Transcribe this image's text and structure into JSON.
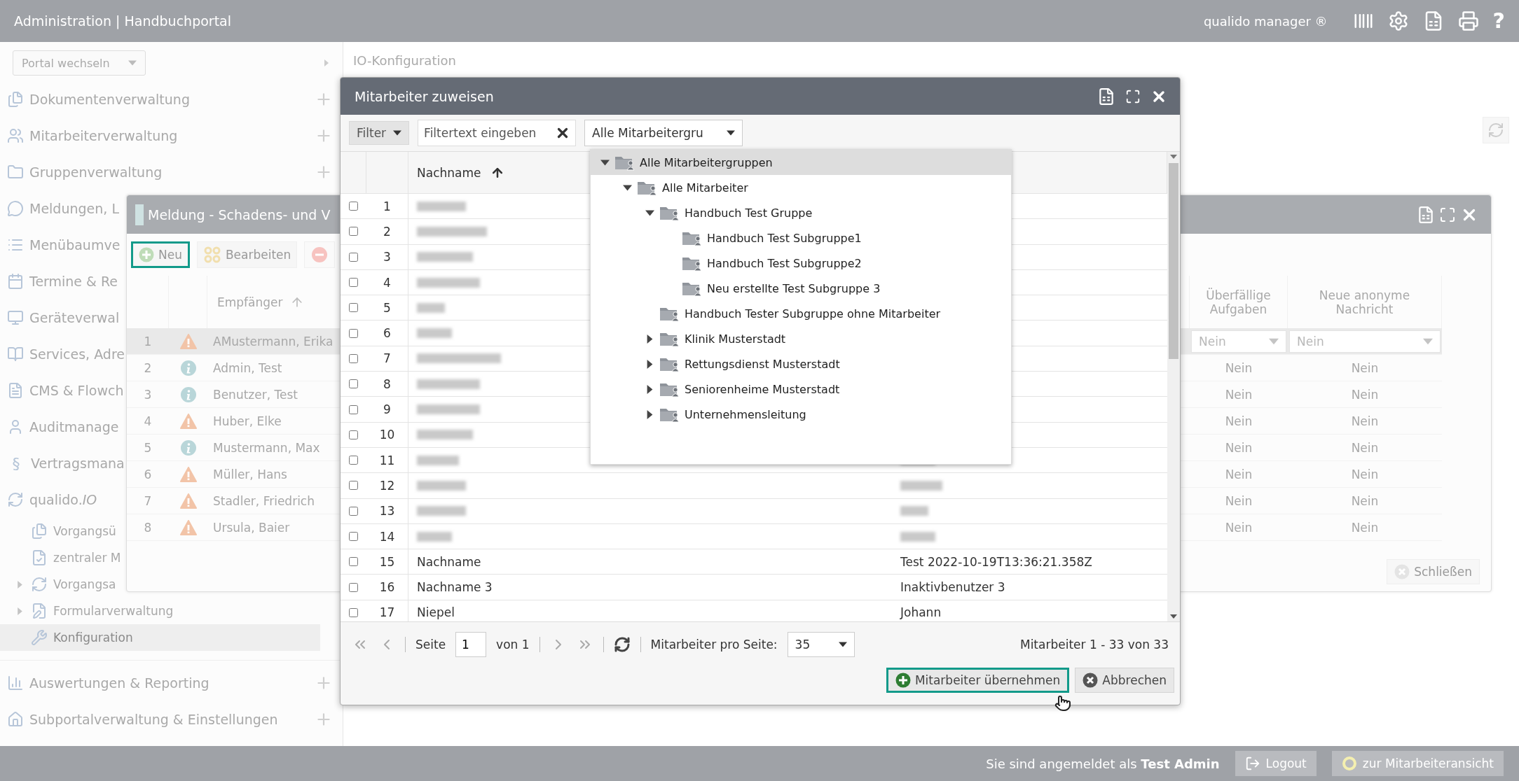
{
  "header": {
    "title": "Administration | Handbuchportal",
    "brand": "qualido manager ®",
    "help": "?"
  },
  "sidebar": {
    "portal_select": "Portal wechseln",
    "items": [
      {
        "label": "Dokumentenverwaltung",
        "expandable": true
      },
      {
        "label": "Mitarbeiterverwaltung",
        "expandable": true
      },
      {
        "label": "Gruppenverwaltung",
        "expandable": true
      },
      {
        "label": "Meldungen, L"
      },
      {
        "label": "Menübaumve"
      },
      {
        "label": "Termine & Re"
      },
      {
        "label": "Geräteverwal"
      },
      {
        "label": "Services, Adre"
      },
      {
        "label": "CMS & Flowch"
      },
      {
        "label": "Auditmanage"
      },
      {
        "label": "Vertragsmana",
        "glyph": "§"
      },
      {
        "label": "qualido.*IO*",
        "children": [
          {
            "label": "Vorgangsü",
            "expandable": false,
            "selected": false
          },
          {
            "label": "zentraler M",
            "expandable": false,
            "selected": false
          },
          {
            "label": "Vorgangsa",
            "expandable": true,
            "selected": false
          },
          {
            "label": "Formularverwaltung",
            "expandable": true,
            "selected": false
          },
          {
            "label": "Konfiguration",
            "expandable": false,
            "selected": true
          }
        ]
      },
      {
        "label": "Auswertungen & Reporting",
        "expandable": true
      },
      {
        "label": "Subportalverwaltung & Einstellungen",
        "expandable": true
      }
    ]
  },
  "page": {
    "title": "IO-Konfiguration"
  },
  "background_dialog": {
    "title": "Meldung - Schadens- und V",
    "toolbar": [
      {
        "label": "Neu",
        "focused": true
      },
      {
        "label": "Bearbeiten",
        "focused": false
      }
    ],
    "columns": [
      "Empfänger",
      "Überfällige Aufgaben",
      "Neue anonyme Nachricht"
    ],
    "rows": [
      {
        "index": "1",
        "kind": "warning",
        "name": "AMustermann, Erika",
        "selected": true,
        "filters": [
          "Nein",
          "Nein"
        ]
      },
      {
        "index": "2",
        "kind": "info",
        "name": "Admin, Test",
        "selected": false,
        "cells": [
          "Nein",
          "Nein"
        ]
      },
      {
        "index": "3",
        "kind": "info",
        "name": "Benutzer, Test",
        "selected": false,
        "cells": [
          "Nein",
          "Nein"
        ]
      },
      {
        "index": "4",
        "kind": "warning",
        "name": "Huber, Elke",
        "selected": false,
        "cells": [
          "Nein",
          "Nein"
        ]
      },
      {
        "index": "5",
        "kind": "info",
        "name": "Mustermann, Max",
        "selected": false,
        "cells": [
          "Nein",
          "Nein"
        ]
      },
      {
        "index": "6",
        "kind": "warning",
        "name": "Müller, Hans",
        "selected": false,
        "cells": [
          "Nein",
          "Nein"
        ]
      },
      {
        "index": "7",
        "kind": "warning",
        "name": "Stadler, Friedrich",
        "selected": false,
        "cells": [
          "Nein",
          "Nein"
        ]
      },
      {
        "index": "8",
        "kind": "warning",
        "name": "Ursula, Baier",
        "selected": false,
        "cells": [
          "Nein",
          "Nein"
        ]
      }
    ],
    "close_button": "Schließen"
  },
  "dialog": {
    "title": "Mitarbeiter zuweisen",
    "filter_button": "Filter",
    "filter_field": {
      "placeholder": "Filtertext eingeben"
    },
    "group_select": "Alle Mitarbeitergru",
    "columns": [
      "Nachname"
    ],
    "rows": [
      {
        "index": "1",
        "checked": false,
        "kind": "masked"
      },
      {
        "index": "2",
        "checked": false,
        "kind": "masked"
      },
      {
        "index": "3",
        "checked": false,
        "kind": "masked"
      },
      {
        "index": "4",
        "checked": false,
        "kind": "masked"
      },
      {
        "index": "5",
        "checked": false,
        "kind": "masked"
      },
      {
        "index": "6",
        "checked": false,
        "kind": "masked"
      },
      {
        "index": "7",
        "checked": false,
        "kind": "masked"
      },
      {
        "index": "8",
        "checked": false,
        "kind": "masked"
      },
      {
        "index": "9",
        "checked": false,
        "kind": "masked"
      },
      {
        "index": "10",
        "checked": false,
        "kind": "masked"
      },
      {
        "index": "11",
        "checked": false,
        "kind": "masked",
        "first_name_masked": true
      },
      {
        "index": "12",
        "checked": false,
        "kind": "masked",
        "first_name_masked": true
      },
      {
        "index": "13",
        "checked": false,
        "kind": "masked",
        "first_name_masked": true
      },
      {
        "index": "14",
        "checked": false,
        "kind": "masked",
        "first_name_masked": true
      },
      {
        "index": "15",
        "checked": false,
        "kind": "plain",
        "last_name": "Nachname",
        "first_name": "Test 2022-10-19T13:36:21.358Z"
      },
      {
        "index": "16",
        "checked": false,
        "kind": "plain",
        "last_name": "Nachname 3",
        "first_name": "Inaktivbenutzer 3"
      },
      {
        "index": "17",
        "checked": false,
        "kind": "plain",
        "last_name": "Niepel",
        "first_name": "Johann"
      }
    ],
    "tree": [
      {
        "label": "Alle Mitarbeitergruppen",
        "expandable": true,
        "expanded": true,
        "selected": true,
        "children": [
          {
            "label": "Alle Mitarbeiter",
            "expandable": true,
            "expanded": true,
            "selected": false,
            "children": [
              {
                "label": "Handbuch Test Gruppe",
                "expandable": true,
                "expanded": true,
                "selected": false,
                "children": [
                  {
                    "label": "Handbuch Test Subgruppe1",
                    "expandable": false,
                    "expanded": false,
                    "selected": false
                  },
                  {
                    "label": "Handbuch Test Subgruppe2",
                    "expandable": false,
                    "expanded": false,
                    "selected": false
                  },
                  {
                    "label": "Neu erstellte Test Subgruppe 3",
                    "expandable": false,
                    "expanded": false,
                    "selected": false
                  }
                ]
              },
              {
                "label": "Handbuch Tester Subgruppe ohne Mitarbeiter",
                "expandable": false,
                "expanded": false,
                "selected": false
              },
              {
                "label": "Klinik Musterstadt",
                "expandable": true,
                "expanded": false,
                "selected": false
              },
              {
                "label": "Rettungsdienst Musterstadt",
                "expandable": true,
                "expanded": false,
                "selected": false
              },
              {
                "label": "Seniorenheime Musterstadt",
                "expandable": true,
                "expanded": false,
                "selected": false
              },
              {
                "label": "Unternehmensleitung",
                "expandable": true,
                "expanded": false,
                "selected": false
              }
            ]
          }
        ]
      }
    ],
    "pager": {
      "page_label": "Seite",
      "page": "1",
      "of": "von 1",
      "per_page_label": "Mitarbeiter pro Seite:",
      "per_page": "35",
      "summary": "Mitarbeiter 1 - 33 von 33"
    },
    "buttons": [
      {
        "label": "Mitarbeiter übernehmen",
        "kind": "primary",
        "focused": true
      },
      {
        "label": "Abbrechen",
        "kind": "cancel",
        "focused": false
      }
    ]
  },
  "footer": {
    "text": "Sie sind angemeldet als **Test Admin**",
    "buttons": [
      "Logout",
      "zur Mitarbeiteransicht"
    ]
  }
}
